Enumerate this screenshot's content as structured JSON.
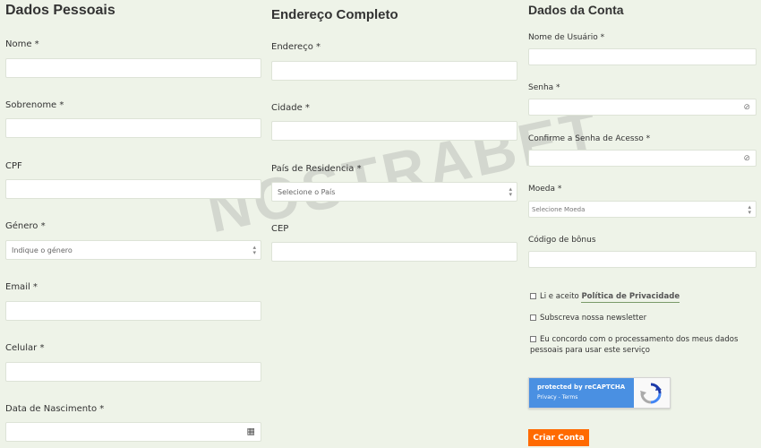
{
  "personal": {
    "title": "Dados Pessoais",
    "nome_label": "Nome *",
    "sobrenome_label": "Sobrenome *",
    "cpf_label": "CPF",
    "genero_label": "Género *",
    "genero_placeholder": "Indique o género",
    "email_label": "Email *",
    "celular_label": "Celular *",
    "nascimento_label": "Data de Nascimento *"
  },
  "address": {
    "title": "Endereço Completo",
    "endereco_label": "Endereço *",
    "cidade_label": "Cidade *",
    "pais_label": "País de Residencia *",
    "pais_placeholder": "Selecione o País",
    "cep_label": "CEP"
  },
  "account": {
    "title": "Dados da Conta",
    "usuario_label": "Nome de Usuário *",
    "senha_label": "Senha *",
    "confirm_label": "Confirme a Senha de Acesso *",
    "moeda_label": "Moeda *",
    "moeda_placeholder": "Selecione Moeda",
    "bonus_label": "Código de bônus",
    "check_privacy_text": "Li e aceito",
    "check_privacy_link": "Política de Privacidade",
    "check_newsletter": "Subscreva nossa newsletter",
    "check_processing": "Eu concordo com o processamento dos meus dados pessoais para usar este serviço",
    "recaptcha_line1": "protected by reCAPTCHA",
    "recaptcha_line2": "Privacy - Terms",
    "submit_label": "Criar Conta"
  },
  "watermark": "NOSTRABET",
  "colors": {
    "background": "#eef3e8",
    "accent": "#ff6a00",
    "recaptcha": "#4a90e2"
  }
}
